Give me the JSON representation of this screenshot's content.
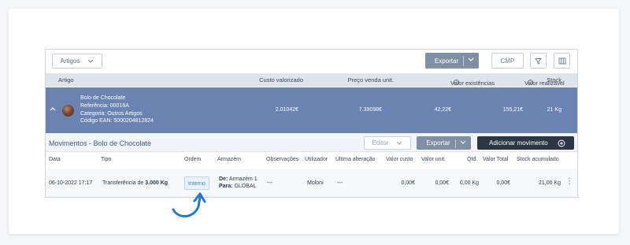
{
  "toolbar": {
    "artigos_label": "Artigos",
    "exportar_label": "Exportar",
    "cmp_label": "CMP",
    "filter_icon": "filter-icon",
    "columns_icon": "columns-icon"
  },
  "main_header": {
    "artigo": "Artigo",
    "custo": "Custo valorizado",
    "preco": "Preço venda unit.",
    "existencias": "Valor existências",
    "realizavel": "Valor realizável",
    "stock": "Stock"
  },
  "product": {
    "name": "Bolo de Chocolate",
    "referencia": "Referência: 00016A",
    "categoria": "Categoria: Outros Artigos",
    "ean": "Código EAN: 5000204812824",
    "custo": "2.01042€",
    "preco": "7.39098€",
    "existencias": "42,22€",
    "realizavel": "155,21€",
    "stock": "21 Kg"
  },
  "movimentos": {
    "title": "Movimentos - Bolo de Chocolate",
    "editor_label": "Editor",
    "exportar_label": "Exportar",
    "add_label": "Adicionar movimento"
  },
  "columns": {
    "data": "Data",
    "tipo": "Tipo",
    "ordem": "Ordem",
    "armazem": "Armazém",
    "observacoes": "Observações",
    "utilizador": "Utilizador",
    "ultima": "Última alteração",
    "valor_custo": "Valor custo",
    "valor_unit": "Valor unit.",
    "qtd": "Qtd.",
    "valor_total": "Valor Total",
    "stock_acumulado": "Stock acumulado"
  },
  "row": {
    "data": "06-10-2022 17:17",
    "tipo_prefix": "Transferência de",
    "tipo_qty": "3.000 Kg",
    "ordem": "Interno",
    "de_label": "De:",
    "de_value": "Armazém 1",
    "para_label": "Para:",
    "para_value": "GLOBAL",
    "observacoes": "---",
    "utilizador": "Moloni",
    "ultima": "---",
    "valor_custo": "0,00€",
    "valor_unit": "0,00€",
    "qtd": "0,00 Kg",
    "valor_total": "0,00€",
    "stock_acumulado": "21,00 Kg",
    "more": "⋮"
  },
  "colors": {
    "accent_blue": "#6a83b0",
    "dark_button": "#2c3644",
    "arrow": "#1f7ad6"
  }
}
